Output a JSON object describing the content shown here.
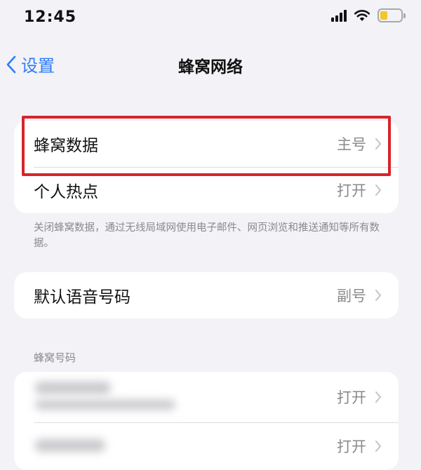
{
  "status_bar": {
    "time": "12:45",
    "battery_color": "#f3c62b"
  },
  "nav": {
    "back_label": "设置",
    "title": "蜂窝网络",
    "accent_color": "#2f7cf6"
  },
  "group1": {
    "rows": [
      {
        "label": "蜂窝数据",
        "value": "主号"
      },
      {
        "label": "个人热点",
        "value": "打开"
      }
    ],
    "footnote": "关闭蜂窝数据，通过无线局域网使用电子邮件、网页浏览和推送通知等所有数据。"
  },
  "group2": {
    "rows": [
      {
        "label": "默认语音号码",
        "value": "副号"
      }
    ]
  },
  "section_header": "蜂窝号码",
  "group3": {
    "rows": [
      {
        "value": "打开"
      },
      {
        "value": "打开"
      }
    ]
  },
  "highlight_color": "#d8232a"
}
